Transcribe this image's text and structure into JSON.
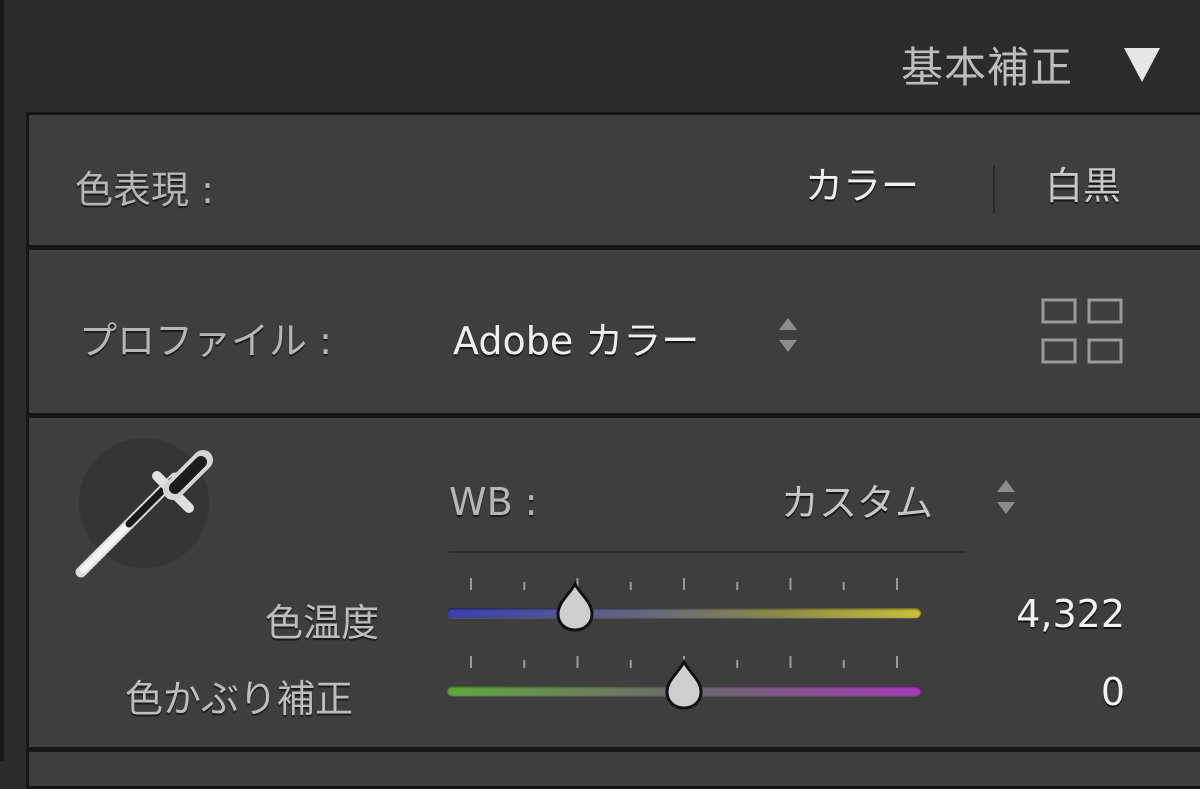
{
  "header": {
    "title": "基本補正"
  },
  "treatment": {
    "label": "色表現 :",
    "color_option": "カラー",
    "bw_option": "白黒"
  },
  "profile": {
    "label": "プロファイル :",
    "value": "Adobe カラー"
  },
  "white_balance": {
    "label": "WB :",
    "value": "カスタム"
  },
  "temperature": {
    "label": "色温度",
    "value": "4,322",
    "position": 0.27
  },
  "tint": {
    "label": "色かぶり補正",
    "value": "0",
    "position": 0.5
  },
  "colors": {
    "panel_bg": "#3e3e3e",
    "temp_track": [
      "#3a3fb0",
      "#8a8a4a",
      "#c2bb3c"
    ],
    "tint_track": [
      "#5ea83c",
      "#6a6a6a",
      "#a63ab8"
    ]
  }
}
